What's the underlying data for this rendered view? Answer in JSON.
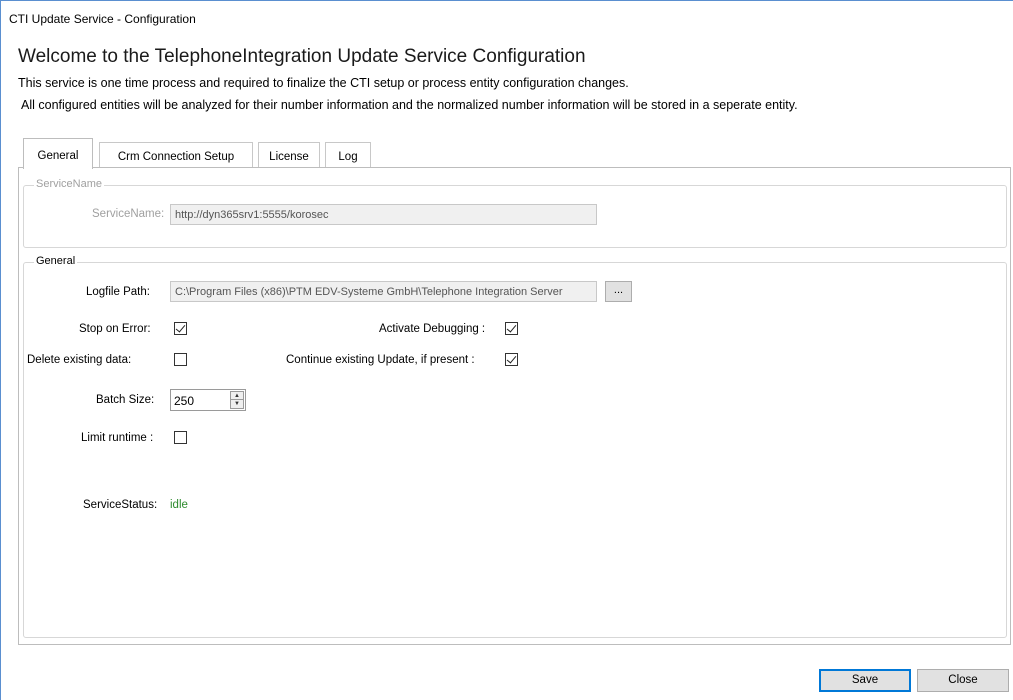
{
  "window": {
    "title": "CTI Update Service - Configuration"
  },
  "header": {
    "heading": "Welcome to the TelephoneIntegration Update Service Configuration",
    "description_line1": "This service is one time process and required to finalize the CTI setup or process entity configuration changes.",
    "description_line2": "All configured entities will be analyzed for their number information and the normalized number information will be stored in a seperate entity."
  },
  "tabs": [
    {
      "label": "General",
      "active": true
    },
    {
      "label": "Crm Connection Setup",
      "active": false
    },
    {
      "label": "License",
      "active": false
    },
    {
      "label": "Log",
      "active": false
    }
  ],
  "service_name_group": {
    "title": "ServiceName",
    "label": "ServiceName:",
    "value": "http://dyn365srv1:5555/korosec"
  },
  "general_group": {
    "title": "General",
    "logfile_label": "Logfile Path:",
    "logfile_value": "C:\\Program Files (x86)\\PTM EDV-Systeme GmbH\\Telephone Integration Server",
    "browse_label": "...",
    "stop_on_error_label": "Stop on Error:",
    "stop_on_error": true,
    "activate_debugging_label": "Activate Debugging :",
    "activate_debugging": true,
    "delete_existing_label": "Delete existing data:",
    "delete_existing": false,
    "continue_existing_label": "Continue existing Update, if present :",
    "continue_existing": true,
    "batch_size_label": "Batch Size:",
    "batch_size": "250",
    "limit_runtime_label": "Limit runtime :",
    "limit_runtime": false,
    "service_status_label": "ServiceStatus:",
    "service_status": "idle",
    "status_color": "#2e8b2e"
  },
  "buttons": {
    "save": "Save",
    "close": "Close"
  }
}
